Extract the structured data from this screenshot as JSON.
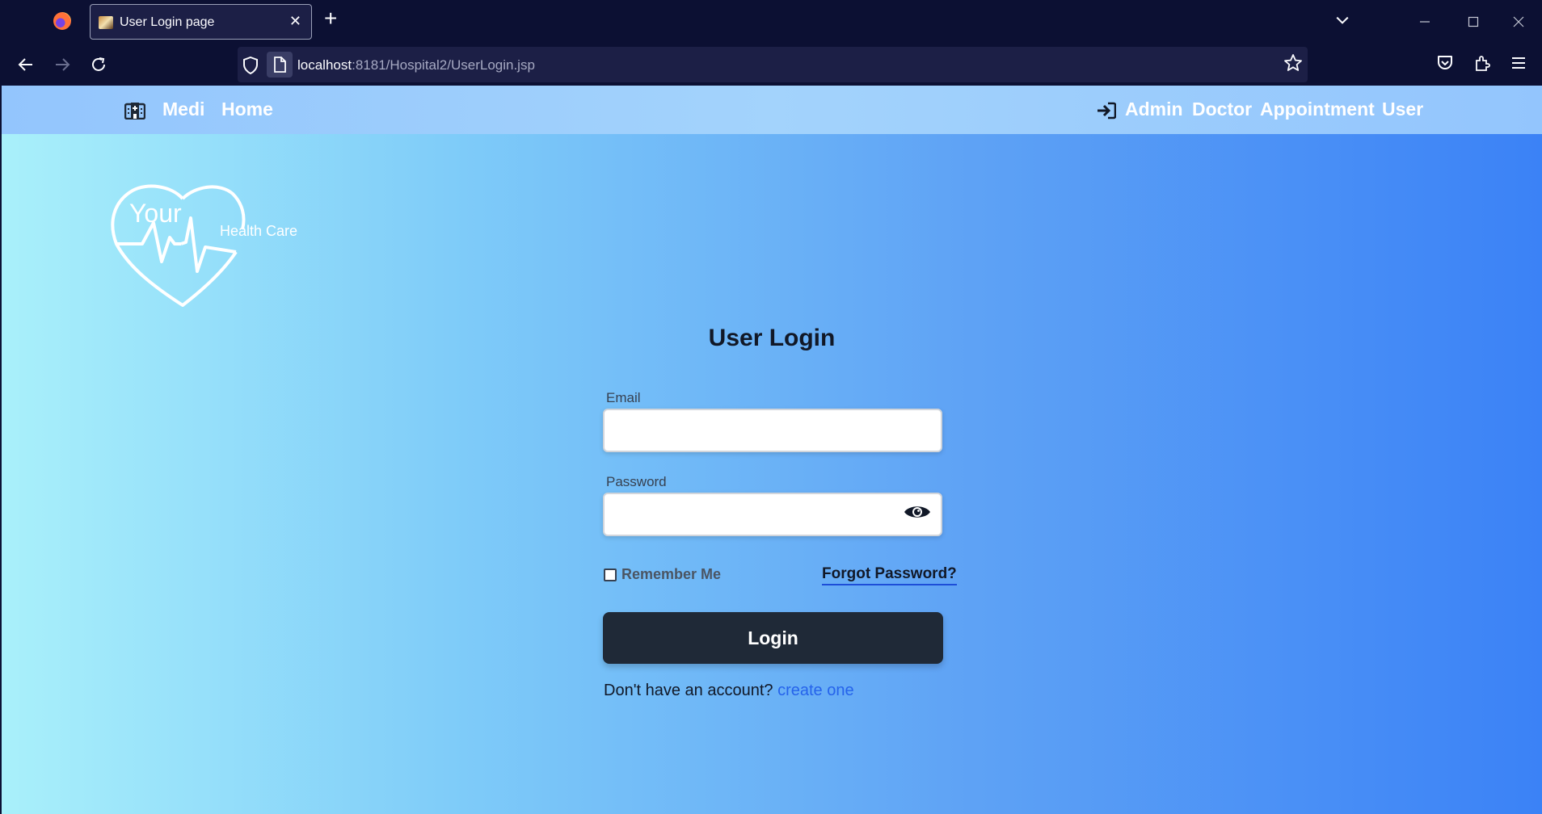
{
  "browser": {
    "tab_title": "User Login page",
    "tab_close": "✕",
    "new_tab": "+",
    "url_host": "localhost",
    "url_rest": ":8181/Hospital2/UserLogin.jsp",
    "icons": [
      "firefox-icon",
      "back-icon",
      "forward-icon",
      "reload-icon",
      "shield-icon",
      "page-icon",
      "bookmark-star-icon",
      "pocket-icon",
      "extensions-icon",
      "menu-icon"
    ]
  },
  "site_nav": {
    "brand": "Medi",
    "home": "Home",
    "links": [
      "Admin",
      "Doctor",
      "Appointment",
      "User"
    ]
  },
  "logo": {
    "line1": "Your",
    "line2": "Health Care"
  },
  "form": {
    "title": "User Login",
    "email_label": "Email",
    "email_value": "",
    "password_label": "Password",
    "password_value": "",
    "remember_label": "Remember Me",
    "remember_checked": false,
    "forgot_label": "Forgot Password?",
    "login_label": "Login",
    "signup_prompt": "Don't have an account?",
    "signup_link": "create one"
  },
  "colors": {
    "nav_bg": "#93c5fd",
    "login_button": "#1f2937",
    "link": "#2563eb"
  }
}
